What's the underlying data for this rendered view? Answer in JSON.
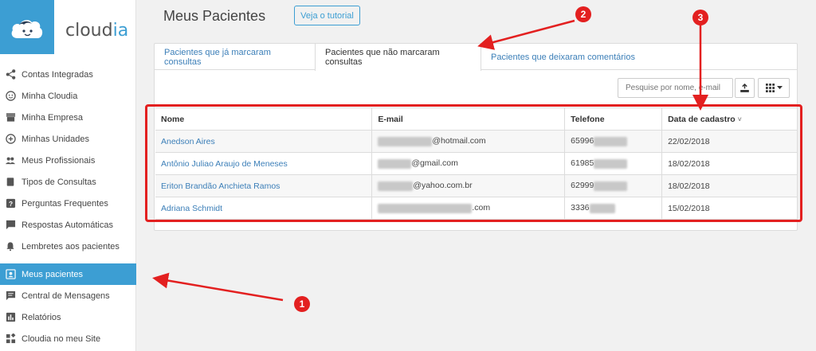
{
  "app": {
    "logo_text": "cloud",
    "logo_accent": "ia",
    "brand_color": "#3c9ed3"
  },
  "sidebar": {
    "items": [
      {
        "label": "Contas Integradas",
        "icon": "share-icon"
      },
      {
        "label": "Minha Cloudia",
        "icon": "face-icon"
      },
      {
        "label": "Minha Empresa",
        "icon": "store-icon"
      },
      {
        "label": "Minhas Unidades",
        "icon": "add-circle-icon"
      },
      {
        "label": "Meus Profissionais",
        "icon": "people-icon"
      },
      {
        "label": "Tipos de Consultas",
        "icon": "list-icon"
      },
      {
        "label": "Perguntas Frequentes",
        "icon": "help-icon"
      },
      {
        "label": "Respostas Automáticas",
        "icon": "chat-icon"
      },
      {
        "label": "Lembretes aos pacientes",
        "icon": "bell-icon"
      },
      {
        "label": "Meus pacientes",
        "icon": "contact-icon",
        "active": true
      },
      {
        "label": "Central de Mensagens",
        "icon": "message-icon"
      },
      {
        "label": "Relatórios",
        "icon": "bar-chart-icon"
      },
      {
        "label": "Cloudia no meu Site",
        "icon": "widgets-icon"
      }
    ]
  },
  "header": {
    "title": "Meus Pacientes",
    "tutorial_label": "Veja o tutorial"
  },
  "tabs": [
    {
      "label": "Pacientes que já marcaram consultas",
      "active": false
    },
    {
      "label": "Pacientes que não marcaram consultas",
      "active": true
    },
    {
      "label": "Pacientes que deixaram comentários",
      "active": false
    }
  ],
  "toolbar": {
    "search_placeholder": "Pesquise por nome, e-mail",
    "export_icon": "export-icon",
    "columns_icon": "grid-icon"
  },
  "table": {
    "columns": [
      "Nome",
      "E-mail",
      "Telefone",
      "Data de cadastro"
    ],
    "sort_indicator": "˅",
    "rows": [
      {
        "name": "Anedson Aires",
        "email": "@hotmail.com",
        "phone": "65996",
        "date": "22/02/2018"
      },
      {
        "name": "Antônio Juliao Araujo de Meneses",
        "email": "@gmail.com",
        "phone": "61985",
        "date": "18/02/2018"
      },
      {
        "name": "Eriton Brandão Anchieta Ramos",
        "email": "@yahoo.com.br",
        "phone": "62999",
        "date": "18/02/2018"
      },
      {
        "name": "Adriana Schmidt",
        "email": ".com",
        "phone": "3336",
        "date": "15/02/2018"
      }
    ]
  },
  "annotations": {
    "badge_1": "1",
    "badge_2": "2",
    "badge_3": "3",
    "color": "#e32020"
  }
}
